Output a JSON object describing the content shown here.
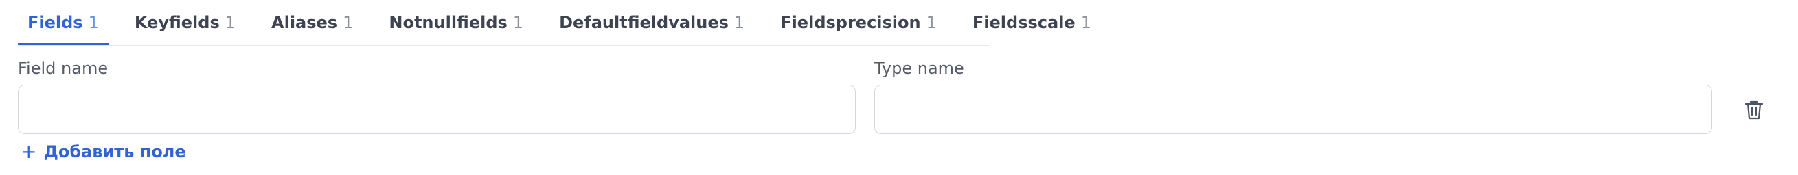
{
  "tabs": [
    {
      "label": "Fields",
      "count": "1",
      "active": true
    },
    {
      "label": "Keyfields",
      "count": "1"
    },
    {
      "label": "Aliases",
      "count": "1"
    },
    {
      "label": "Notnullfields",
      "count": "1"
    },
    {
      "label": "Defaultfieldvalues",
      "count": "1"
    },
    {
      "label": "Fieldsprecision",
      "count": "1"
    },
    {
      "label": "Fieldsscale",
      "count": "1"
    }
  ],
  "form": {
    "field_name_label": "Field name",
    "field_name_value": "",
    "type_name_label": "Type name",
    "type_name_value": "",
    "add_field_label": "Добавить поле",
    "add_icon": "plus-icon",
    "delete_icon": "trash-icon"
  },
  "colors": {
    "accent": "#2f63d6",
    "tab_text": "#3d4350",
    "count_text": "#8a8f99",
    "border": "#d4d7dd"
  }
}
